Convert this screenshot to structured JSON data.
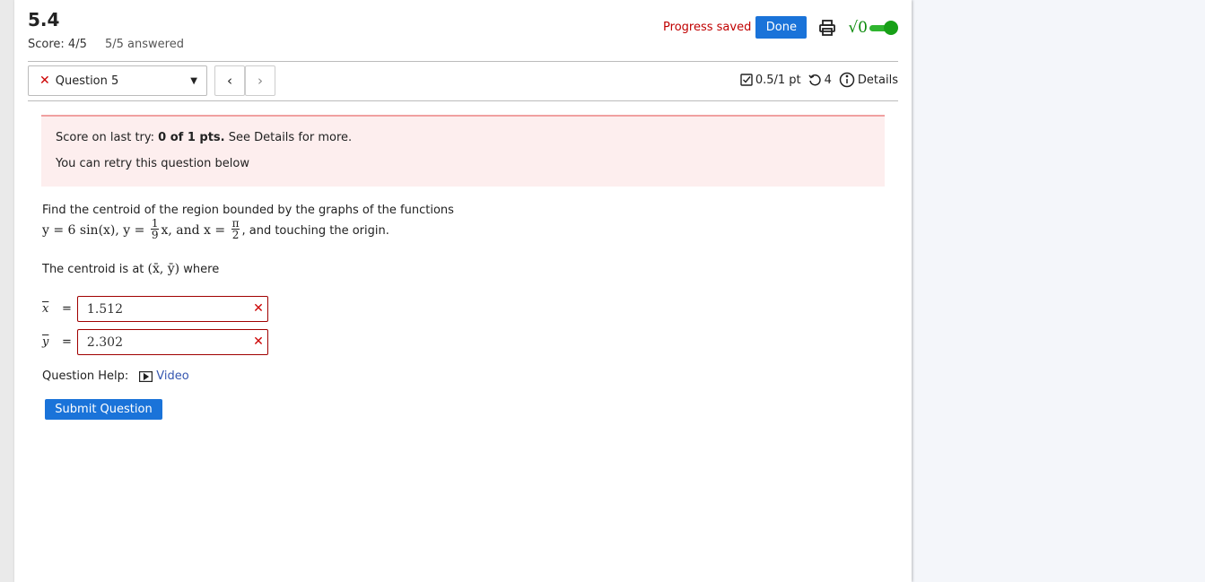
{
  "header": {
    "title": "5.4",
    "score_label": "Score: 4/5",
    "answered": "5/5 answered",
    "progress_saved": "Progress saved",
    "done_label": "Done",
    "sqrt_symbol": "√0"
  },
  "navigation": {
    "question_label": "Question 5",
    "prev": "‹",
    "next": "›"
  },
  "meta": {
    "points": "0.5/1 pt",
    "attempts": "4",
    "details": "Details"
  },
  "alert": {
    "last_try_prefix": "Score on last try: ",
    "last_try_score": "0 of 1 pts.",
    "last_try_suffix": " See Details for more.",
    "retry_text": "You can retry this question below"
  },
  "question": {
    "line1": "Find the centroid of the region bounded by the graphs of the functions",
    "func1": "y = 6 sin(x), y = ",
    "frac1_num": "1",
    "frac1_den": "9",
    "func2": "x,  and  x = ",
    "frac2_num": "π",
    "frac2_den": "2",
    "func3": ", and touching the origin.",
    "centroid_prefix": "The centroid is at ",
    "centroid_math": "(x̄, ȳ)",
    "centroid_suffix": " where"
  },
  "answers": [
    {
      "label": "x",
      "value": "1.512"
    },
    {
      "label": "y",
      "value": "2.302"
    }
  ],
  "help": {
    "label": "Question Help:",
    "video": "Video"
  },
  "submit_label": "Submit Question",
  "colors": {
    "accent": "#1a73d9",
    "error": "#c00000",
    "alert_bg": "#fdeeee",
    "toggle": "#17a017"
  }
}
